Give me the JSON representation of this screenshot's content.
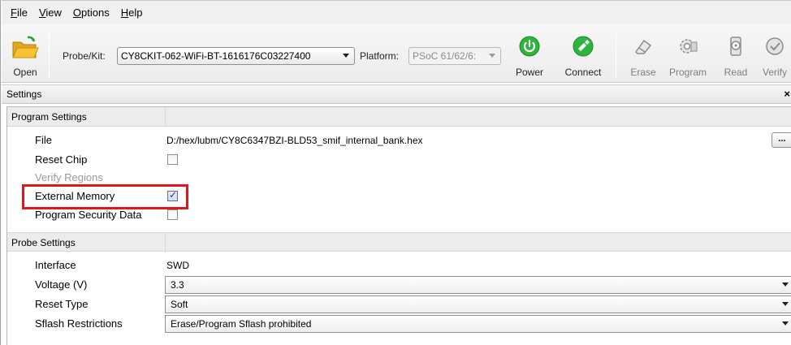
{
  "menu": {
    "items": [
      {
        "label": "File",
        "u": "F",
        "rest": "ile"
      },
      {
        "label": "View",
        "u": "V",
        "rest": "iew"
      },
      {
        "label": "Options",
        "u": "O",
        "rest": "ptions"
      },
      {
        "label": "Help",
        "u": "H",
        "rest": "elp"
      }
    ]
  },
  "toolbar": {
    "open_label": "Open",
    "probe_label": "Probe/Kit:",
    "probe_value": "CY8CKIT-062-WiFi-BT-1616176C03227400",
    "platform_label": "Platform:",
    "platform_value": "PSoC 61/62/6:",
    "power_label": "Power",
    "connect_label": "Connect",
    "erase_label": "Erase",
    "program_label": "Program",
    "read_label": "Read",
    "verify_label": "Verify"
  },
  "settings": {
    "title": "Settings",
    "close": "×",
    "program_group": {
      "header": "Program Settings",
      "file_label": "File",
      "file_value": "D:/hex/lubm/CY8C6347BZI-BLD53_smif_internal_bank.hex",
      "browse_label": "...",
      "reset_chip_label": "Reset Chip",
      "reset_chip_checked": false,
      "verify_regions_label": "Verify Regions",
      "external_memory_label": "External Memory",
      "external_memory_checked": true,
      "security_label": "Program Security Data",
      "security_checked": false
    },
    "probe_group": {
      "header": "Probe Settings",
      "interface_label": "Interface",
      "interface_value": "SWD",
      "voltage_label": "Voltage (V)",
      "voltage_value": "3.3",
      "reset_type_label": "Reset Type",
      "reset_type_value": "Soft",
      "sflash_label": "Sflash Restrictions",
      "sflash_value": "Erase/Program Sflash prohibited"
    }
  },
  "colors": {
    "highlight": "#e0161b",
    "power_green": "#2fb43f",
    "connect_green": "#2fb43f",
    "folder_yellow": "#f6c431"
  },
  "icons": [
    "folder-open-icon",
    "power-icon",
    "connect-icon",
    "erase-icon",
    "program-icon",
    "read-icon",
    "verify-icon"
  ]
}
